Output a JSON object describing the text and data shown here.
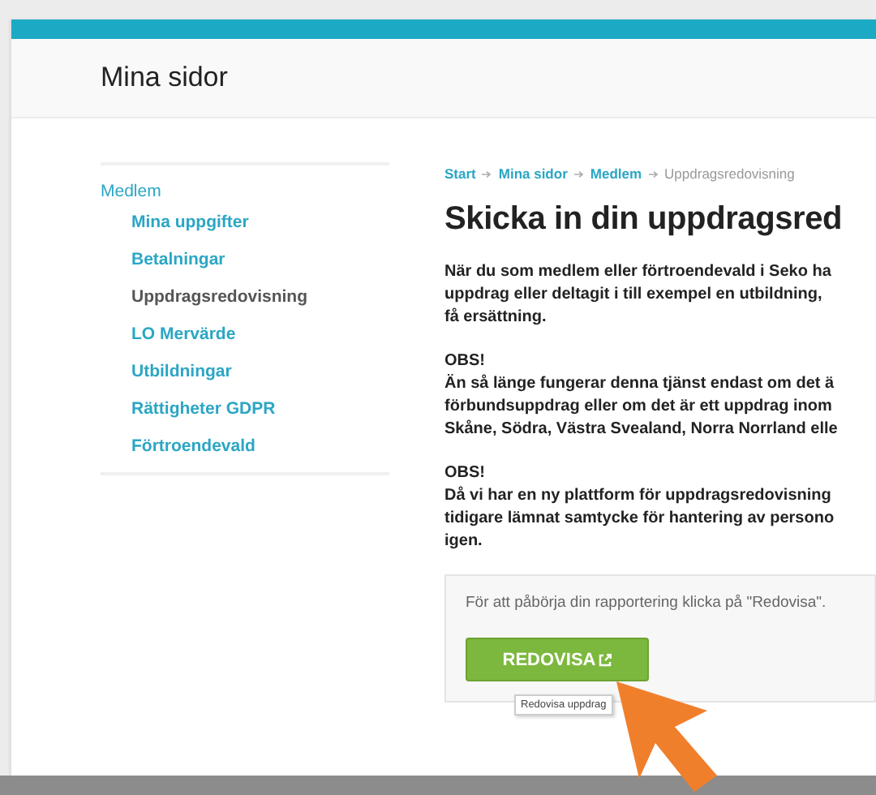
{
  "header": {
    "title": "Mina sidor"
  },
  "sidebar": {
    "section": "Medlem",
    "items": [
      {
        "label": "Mina uppgifter",
        "selected": false
      },
      {
        "label": "Betalningar",
        "selected": false
      },
      {
        "label": "Uppdragsredovisning",
        "selected": true
      },
      {
        "label": "LO Mervärde",
        "selected": false
      },
      {
        "label": "Utbildningar",
        "selected": false
      },
      {
        "label": "Rättigheter GDPR",
        "selected": false
      },
      {
        "label": "Förtroendevald",
        "selected": false
      }
    ]
  },
  "breadcrumb": [
    {
      "label": "Start",
      "selected": false
    },
    {
      "label": "Mina sidor",
      "selected": false
    },
    {
      "label": "Medlem",
      "selected": false
    },
    {
      "label": "Uppdragsredovisning",
      "selected": true
    }
  ],
  "heading": "Skicka in din uppdragsred",
  "paragraphs": [
    {
      "lines": [
        "När du som medlem eller förtroendevald i Seko ha",
        "uppdrag eller deltagit i till exempel en utbildning,",
        "få ersättning."
      ]
    },
    {
      "lines": [
        "OBS!",
        "Än så länge fungerar denna tjänst endast om det ä",
        "förbundsuppdrag eller om det är ett uppdrag inom",
        "Skåne, Södra, Västra Svealand, Norra Norrland elle"
      ]
    },
    {
      "lines": [
        "OBS!",
        "Då vi har en ny plattform för uppdragsredovisning",
        "tidigare lämnat samtycke för hantering av persono",
        "igen."
      ]
    }
  ],
  "notice": {
    "text": "För att påbörja din rapportering klicka på \"Redovisa\".",
    "button": "REDOVISA",
    "tooltip": "Redovisa uppdrag"
  }
}
